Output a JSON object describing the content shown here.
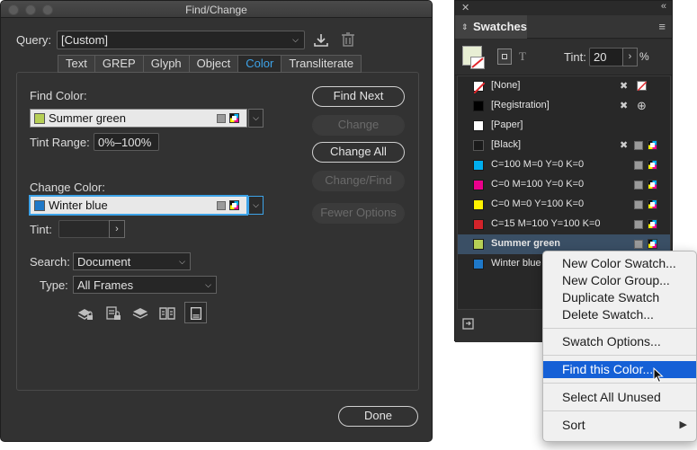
{
  "find_change": {
    "title": "Find/Change",
    "query_label": "Query:",
    "query_value": "[Custom]",
    "tabs": [
      {
        "label": "Text"
      },
      {
        "label": "GREP"
      },
      {
        "label": "Glyph"
      },
      {
        "label": "Object"
      },
      {
        "label": "Color"
      },
      {
        "label": "Transliterate"
      }
    ],
    "active_tab": "Color",
    "find_color_label": "Find Color:",
    "find_color_value": "Summer green",
    "tint_range_label": "Tint Range:",
    "tint_range_value": "0%–100%",
    "change_color_label": "Change Color:",
    "change_color_value": "Winter blue",
    "tint_label": "Tint:",
    "tint_value": "",
    "search_label": "Search:",
    "search_value": "Document",
    "type_label": "Type:",
    "type_value": "All Frames",
    "buttons": {
      "find_next": "Find Next",
      "change": "Change",
      "change_all": "Change All",
      "change_find": "Change/Find",
      "fewer_options": "Fewer Options",
      "done": "Done"
    },
    "colors": {
      "summer_green": "#b6cf55",
      "winter_blue": "#1e78c8"
    }
  },
  "swatches": {
    "tab_label": "Swatches",
    "tint_label": "Tint:",
    "tint_value": "20",
    "tint_unit": "%",
    "items": [
      {
        "name": "[None]",
        "color": "#ffffff"
      },
      {
        "name": "[Registration]",
        "color": "#000000"
      },
      {
        "name": "[Paper]",
        "color": "#ffffff"
      },
      {
        "name": "[Black]",
        "color": "#1a1a1a"
      },
      {
        "name": "C=100 M=0 Y=0 K=0",
        "color": "#00aeef"
      },
      {
        "name": "C=0 M=100 Y=0 K=0",
        "color": "#ec008c"
      },
      {
        "name": "C=0 M=0 Y=100 K=0",
        "color": "#fff200"
      },
      {
        "name": "C=15 M=100 Y=100 K=0",
        "color": "#d2232a"
      },
      {
        "name": "Summer green",
        "color": "#b6cf55"
      },
      {
        "name": "Winter blue",
        "color": "#1e78c8"
      }
    ]
  },
  "context_menu": {
    "items": [
      "New Color Swatch...",
      "New Color Group...",
      "Duplicate Swatch",
      "Delete Swatch...",
      "Swatch Options...",
      "Find this Color...",
      "Select All Unused",
      "Sort"
    ],
    "highlighted": "Find this Color..."
  }
}
